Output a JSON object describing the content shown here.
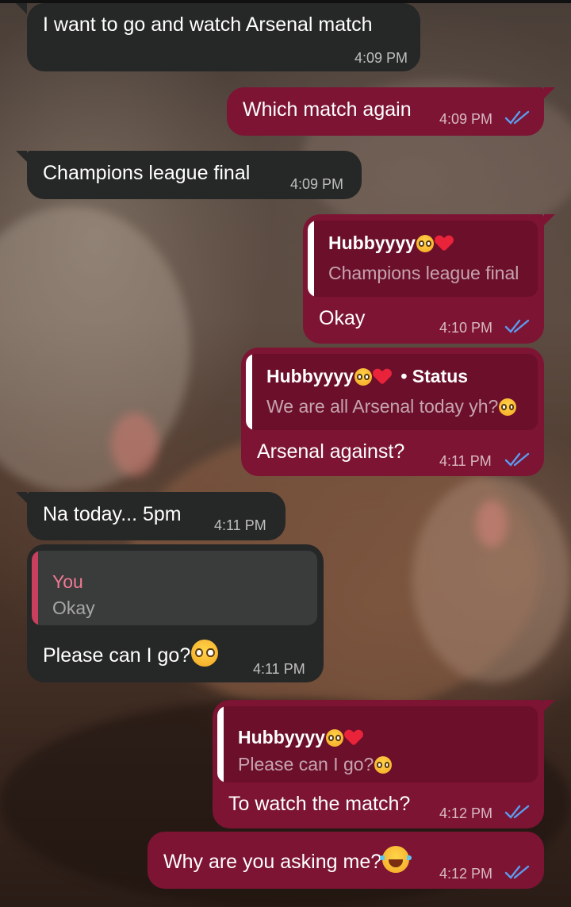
{
  "chat": {
    "messages": [
      {
        "direction": "incoming",
        "text": "I want to go and watch Arsenal match",
        "time": "4:09 PM"
      },
      {
        "direction": "outgoing",
        "text": "Which match again",
        "time": "4:09 PM",
        "read": true
      },
      {
        "direction": "incoming",
        "text": "Champions league final",
        "time": "4:09 PM"
      },
      {
        "direction": "outgoing",
        "text": "Okay",
        "time": "4:10 PM",
        "read": true,
        "reply_to": {
          "name": "Hubbyyyy",
          "text": "Champions league final"
        }
      },
      {
        "direction": "outgoing",
        "text": "Arsenal against?",
        "time": "4:11 PM",
        "read": true,
        "reply_to": {
          "name": "Hubbyyyy",
          "suffix": "• Status",
          "text": "We are all Arsenal today yh?"
        }
      },
      {
        "direction": "incoming",
        "text": "Na today... 5pm",
        "time": "4:11 PM"
      },
      {
        "direction": "incoming",
        "text": "Please can I go?",
        "time": "4:11 PM",
        "reply_to": {
          "name": "You",
          "text": "Okay"
        }
      },
      {
        "direction": "outgoing",
        "text": "To watch the match?",
        "time": "4:12 PM",
        "read": true,
        "reply_to": {
          "name": "Hubbyyyy",
          "text": "Please can I go?"
        }
      },
      {
        "direction": "outgoing",
        "text": "Why are you asking me?",
        "time": "4:12 PM",
        "read": true
      }
    ]
  },
  "colors": {
    "incoming_bubble": "#262727",
    "outgoing_bubble": "#7d1433",
    "read_ticks": "#5b9cf0",
    "you_quote_accent": "#c8405e"
  },
  "icons": {
    "read_receipt": "double-check-icon",
    "emoji_pleading": "pleading-face-emoji",
    "emoji_heart": "red-heart-emoji",
    "emoji_joy": "face-with-tears-of-joy-emoji"
  }
}
